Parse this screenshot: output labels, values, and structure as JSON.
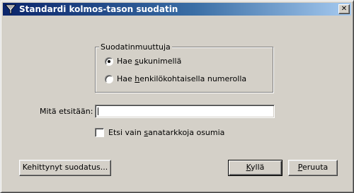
{
  "window": {
    "title": "Standardi kolmos-tason suodatin",
    "close_glyph": "✕"
  },
  "group": {
    "legend": "Suodatinmuuttuja",
    "options": [
      {
        "label_pre": "Hae ",
        "label_key": "s",
        "label_post": "ukunimellä",
        "checked": true
      },
      {
        "label_pre": "Hae ",
        "label_key": "h",
        "label_post": "enkilökohtaisella numerolla",
        "checked": false
      }
    ]
  },
  "search": {
    "label": "Mitä etsitään:",
    "value": ""
  },
  "exact_match": {
    "label_pre": "Etsi vain ",
    "label_key": "s",
    "label_post": "anatarkkoja osumia",
    "checked": false
  },
  "buttons": {
    "advanced": "Kehittynyt suodatus...",
    "ok_key": "K",
    "ok_rest": "yllä",
    "cancel_key": "P",
    "cancel_rest": "eruuta"
  },
  "icons": {
    "title_icon": "filter-funnel-icon"
  }
}
